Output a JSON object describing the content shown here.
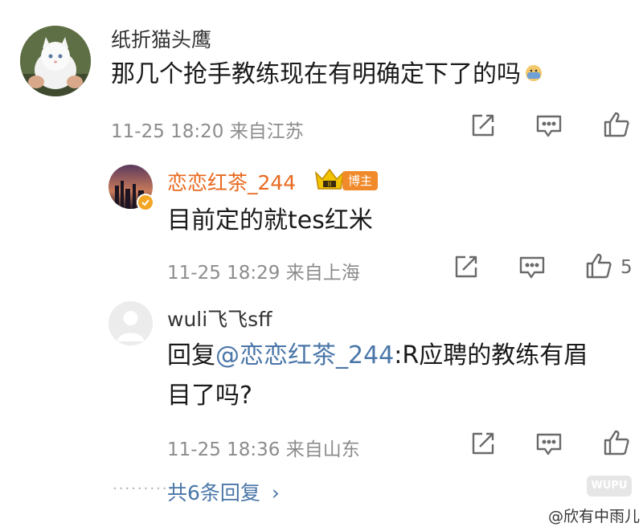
{
  "comment": {
    "username": "纸折猫头鹰",
    "text": "那几个抢手教练现在有明确定下了的吗",
    "meta": "11-25 18:20 来自江苏",
    "emoji_icon": "doge-face-emoji",
    "like_count": ""
  },
  "reply1": {
    "username": "恋恋红茶_244",
    "badge": "博主",
    "crown_icon": "crown-icon",
    "text": "目前定的就tes红米",
    "meta": "11-25 18:29 来自上海",
    "like_count": "5"
  },
  "reply2": {
    "username": "wuli飞飞sff",
    "prefix": "回复",
    "mention": "@恋恋红茶_244",
    "text_line1": ":R应聘的教练有眉",
    "text_line2": "目了吗?",
    "meta": "11-25 18:36 来自山东",
    "like_count": ""
  },
  "more": {
    "dots": "··········",
    "label": "共6条回复",
    "chevron": "›"
  },
  "watermark": {
    "logo_text": "WUPU",
    "credit": "@欣有中雨儿"
  },
  "colors": {
    "accent_orange": "#e8691f",
    "link_blue": "#4a76a8",
    "meta_gray": "#8c8c8c"
  }
}
